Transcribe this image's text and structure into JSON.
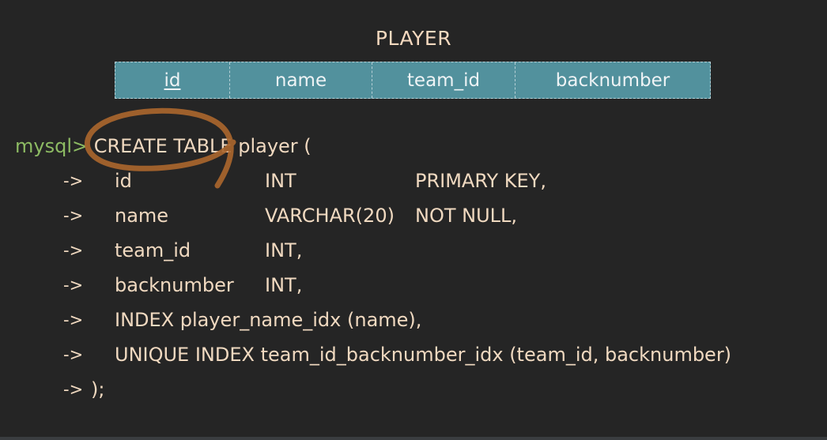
{
  "diagram": {
    "title": "PLAYER",
    "columns": [
      "id",
      "name",
      "team_id",
      "backnumber"
    ]
  },
  "sql": {
    "prompt": "mysql>",
    "create": "CREATE TABLE",
    "create_rest": " player (",
    "arrow": "->",
    "rows": [
      {
        "name": "id",
        "type": "INT",
        "constraint": "PRIMARY KEY,"
      },
      {
        "name": "name",
        "type": "VARCHAR(20)",
        "constraint": "NOT NULL,"
      },
      {
        "name": "team_id",
        "type": "INT,",
        "constraint": ""
      },
      {
        "name": "backnumber",
        "type": "INT,",
        "constraint": ""
      }
    ],
    "index_line": "INDEX player_name_idx (name),",
    "unique_line": "UNIQUE INDEX team_id_backnumber_idx (team_id, backnumber)",
    "end_line": ");"
  },
  "colors": {
    "background": "#252525",
    "header_fill": "#52919d",
    "prompt": "#8dbb63",
    "text": "#f0d9c0",
    "annotation": "#a8652d"
  }
}
